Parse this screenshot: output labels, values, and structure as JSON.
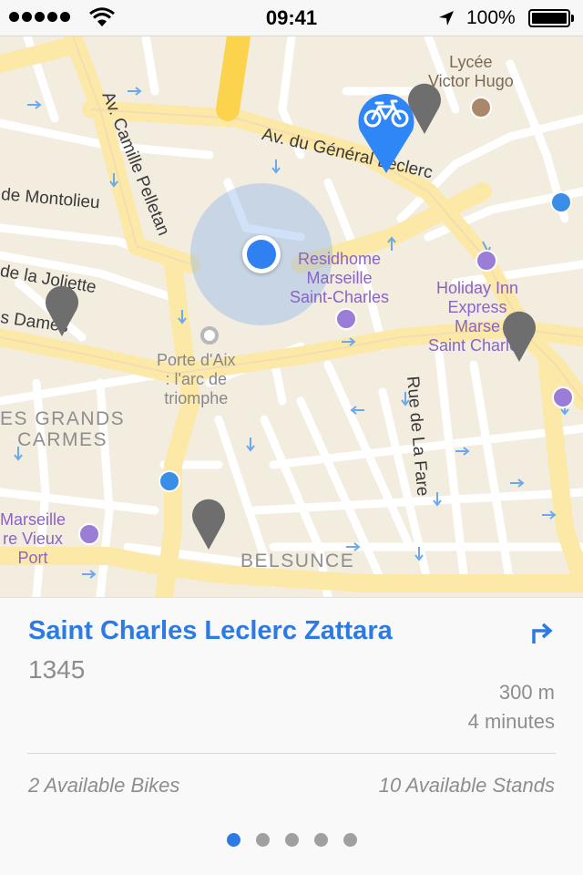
{
  "status_bar": {
    "time": "09:41",
    "battery": "100%",
    "signal_dots": 5,
    "icons": [
      "signal-dots-icon",
      "wifi-icon",
      "location-arrow-icon",
      "battery-icon"
    ]
  },
  "map": {
    "streets": [
      "Av. Camille Pelletan",
      "Av. du Général Leclerc",
      "de Montolieu",
      "de la Joliette",
      "s Dames",
      "Rue de La Fare"
    ],
    "districts": {
      "grands_carmes": [
        "ES GRANDS",
        "CARMES"
      ],
      "belsunce": "BELSUNCE"
    },
    "pois": {
      "residhome": [
        "Residhome",
        "Marseille",
        "Saint-Charles"
      ],
      "holiday_inn": [
        "Holiday Inn",
        "Express",
        "Marse",
        "Saint Charles"
      ],
      "lycee": [
        "Lycée",
        "Victor Hugo"
      ],
      "porte_aix": [
        "Porte d'Aix",
        ": l'arc de",
        "triomphe"
      ],
      "marseille_vieux_port": [
        "Marseille",
        "re Vieux",
        "Port"
      ]
    },
    "icons": [
      "bicycle-icon",
      "user-location-icon",
      "hotel-icon",
      "metro-icon",
      "school-icon",
      "landmark-icon"
    ]
  },
  "station": {
    "name": "Saint Charles Leclerc Zattara",
    "id": "1345",
    "distance": "300 m",
    "duration": "4 minutes",
    "bikes": "2 Available Bikes",
    "stands": "10 Available Stands"
  },
  "pager": {
    "pages": 5,
    "active_index": 0
  },
  "colors": {
    "accent": "#2c7be5",
    "map_background": "#f3ede0",
    "road": "#fce9a8",
    "highway": "#fcd34d",
    "pin_gray": "#6e6e6e",
    "poi_purple": "#8a63c9",
    "location_dot": "#2f80f0"
  }
}
